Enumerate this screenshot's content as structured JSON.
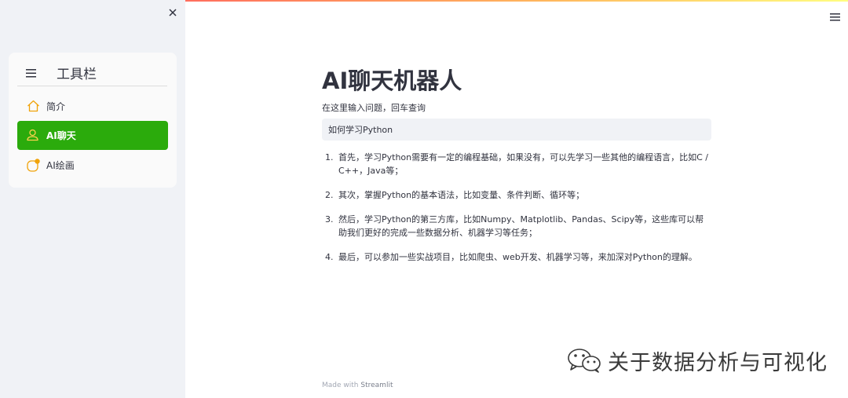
{
  "sidebar": {
    "title": "工具栏",
    "items": [
      {
        "label": "简介",
        "icon": "house-icon",
        "active": false
      },
      {
        "label": "AI聊天",
        "icon": "person-icon",
        "active": true
      },
      {
        "label": "AI绘画",
        "icon": "badge-circle-icon",
        "active": false
      }
    ],
    "accent_color": "#2bab0c"
  },
  "main": {
    "title": "AI聊天机器人",
    "input_label": "在这里输入问题，回车查询",
    "input_value": "如何学习Python",
    "answers": [
      {
        "num": "1.",
        "text": "首先，学习Python需要有一定的编程基础，如果没有，可以先学习一些其他的编程语言，比如C / C++，Java等；"
      },
      {
        "num": "2.",
        "text": "其次，掌握Python的基本语法，比如变量、条件判断、循环等；"
      },
      {
        "num": "3.",
        "text": "然后，学习Python的第三方库，比如Numpy、Matplotlib、Pandas、Scipy等，这些库可以帮助我们更好的完成一些数据分析、机器学习等任务；"
      },
      {
        "num": "4.",
        "text": "最后，可以参加一些实战项目，比如爬虫、web开发、机器学习等，来加深对Python的理解。"
      }
    ]
  },
  "footer": {
    "prefix": "Made with",
    "brand": "Streamlit"
  },
  "watermark": {
    "text": "关于数据分析与可视化",
    "icon": "wechat-icon"
  }
}
